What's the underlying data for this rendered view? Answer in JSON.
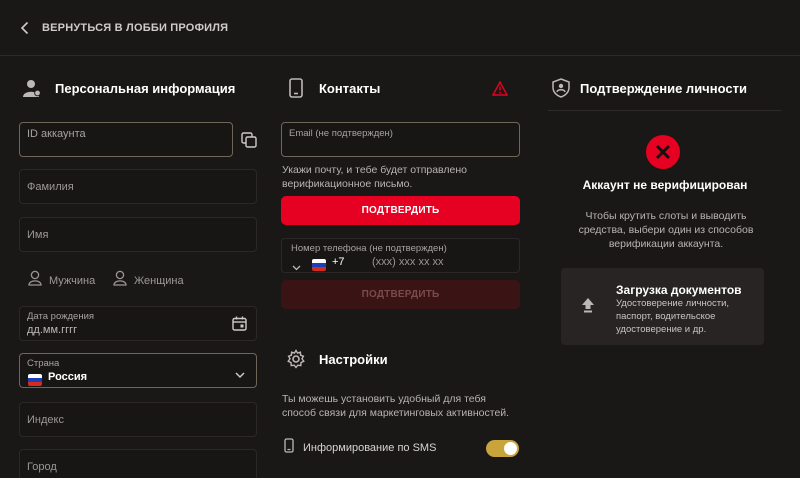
{
  "topbar": {
    "back_label": "ВЕРНУТЬСЯ В ЛОББИ ПРОФИЛЯ"
  },
  "personal": {
    "title": "Персональная информация",
    "account_id_label": "ID аккаунта",
    "last_name_placeholder": "Фамилия",
    "first_name_placeholder": "Имя",
    "gender_male": "Мужчина",
    "gender_female": "Женщина",
    "birth_label": "Дата рождения",
    "birth_placeholder": "дд.мм.гггг",
    "country_label": "Страна",
    "country_value": "Россия",
    "postal_placeholder": "Индекс",
    "city_placeholder": "Город"
  },
  "contacts": {
    "title": "Контакты",
    "email_label": "Email (не подтвержден)",
    "email_help": "Укажи почту, и тебе будет отправлено верификационное письмо.",
    "confirm_button": "ПОДТВЕРДИТЬ",
    "phone_label": "Номер телефона (не подтвержден)",
    "phone_code": "+7",
    "phone_placeholder": "(xxx) xxx xx xx",
    "phone_confirm_button": "ПОДТВЕРДИТЬ"
  },
  "settings": {
    "title": "Настройки",
    "description": "Ты можешь установить удобный для тебя способ связи для маркетинговых активностей.",
    "sms_label": "Информирование по SMS",
    "sms_enabled": true
  },
  "identity": {
    "title": "Подтверждение личности",
    "status": "Аккаунт не верифицирован",
    "description": "Чтобы крутить слоты и выводить средства, выбери один из способов верификации аккаунта.",
    "upload_title": "Загрузка документов",
    "upload_description": "Удостоверение личности, паспорт, водительское удостоверение и др."
  },
  "colors": {
    "accent": "#e60021",
    "toggle": "#c9a43a",
    "background": "#1a1717"
  },
  "icons": [
    "chevron-left-icon",
    "user-icon",
    "phone-icon",
    "warning-icon",
    "shield-user-icon",
    "copy-icon",
    "calendar-icon",
    "chevron-down-icon",
    "gear-icon",
    "error-x-icon",
    "upload-icon",
    "russia-flag-icon"
  ]
}
